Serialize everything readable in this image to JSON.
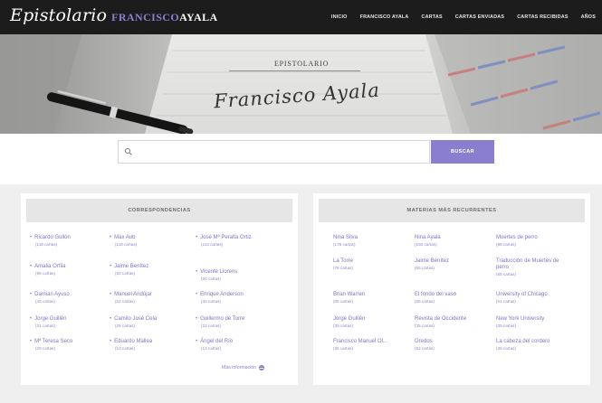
{
  "header": {
    "logo_script": "Epistolario",
    "logo_first": "FRANCISCO",
    "logo_last": "AYALA",
    "nav": [
      "INICIO",
      "FRANCISCO AYALA",
      "CARTAS",
      "CARTAS ENVIADAS",
      "CARTAS RECIBIDAS",
      "AÑOS"
    ]
  },
  "hero": {
    "heading": "EPISTOLARIO",
    "signature": "Francisco Ayala"
  },
  "search": {
    "placeholder": "",
    "button_label": "BUSCAR"
  },
  "correspondencias": {
    "title": "CORRESPONDENCIAS",
    "columns": [
      [
        {
          "name": "Ricardo Gullón",
          "count": "(118 cartas)"
        },
        {
          "name": "Amalia Orfila",
          "count": "(98 cartas)"
        },
        {
          "name": "Damián Ayuso",
          "count": "(45 cartas)"
        },
        {
          "name": "Jorge Guillén",
          "count": "(31 cartas)"
        },
        {
          "name": "Mª Teresa Seco",
          "count": "(29 cartas)"
        }
      ],
      [
        {
          "name": "Max Aub",
          "count": "(118 cartas)"
        },
        {
          "name": "Jaime Benítez",
          "count": "(50 cartas)"
        },
        {
          "name": "Manuel Andújar",
          "count": "(32 cartas)"
        },
        {
          "name": "Camilo José Cela",
          "count": "(29 cartas)"
        },
        {
          "name": "Eduardo Mallea",
          "count": "(13 cartas)"
        }
      ],
      [
        {
          "name": "José Mª Peralta Ortiz",
          "count": "(113 cartas)"
        },
        {
          "name": "Vicente Llorens",
          "count": "(50 cartas)"
        },
        {
          "name": "Enrique Anderson",
          "count": "(32 cartas)"
        },
        {
          "name": "Guillermo de Torre",
          "count": "(23 cartas)"
        },
        {
          "name": "Ángel del Río",
          "count": "(13 cartas)"
        }
      ]
    ],
    "more_label": "Más información"
  },
  "materias": {
    "title": "MATERIAS MÁS RECURRENTES",
    "columns": [
      [
        {
          "name": "Nina Silva",
          "count": "(175 cartas)"
        },
        {
          "name": "La Torre",
          "count": "(78 cartas)"
        },
        {
          "name": "Brian Warren",
          "count": "(65 cartas)"
        },
        {
          "name": "Jorge Guillén",
          "count": "(35 cartas)"
        },
        {
          "name": "Francisco Manuel Ol...",
          "count": "(35 cartas)"
        }
      ],
      [
        {
          "name": "Nina Ayala",
          "count": "(150 cartas)"
        },
        {
          "name": "Jaime Benítez",
          "count": "(65 cartas)"
        },
        {
          "name": "El fondo del vaso",
          "count": "(55 cartas)"
        },
        {
          "name": "Revista de Occidente",
          "count": "(35 cartas)"
        },
        {
          "name": "Gredos",
          "count": "(62 cartas)"
        }
      ],
      [
        {
          "name": "Muertes de perro",
          "count": "(98 cartas)"
        },
        {
          "name": "Traducción de Muertes de perro",
          "count": "(65 cartas)"
        },
        {
          "name": "University of Chicago",
          "count": "(51 cartas)"
        },
        {
          "name": "New York University",
          "count": "(35 cartas)"
        },
        {
          "name": "La cabeza del cordero",
          "count": "(35 cartas)"
        }
      ]
    ]
  },
  "colors": {
    "accent": "#8a7fcf",
    "topbar": "#1c1c1c",
    "panel_head": "#e6e6e6"
  }
}
